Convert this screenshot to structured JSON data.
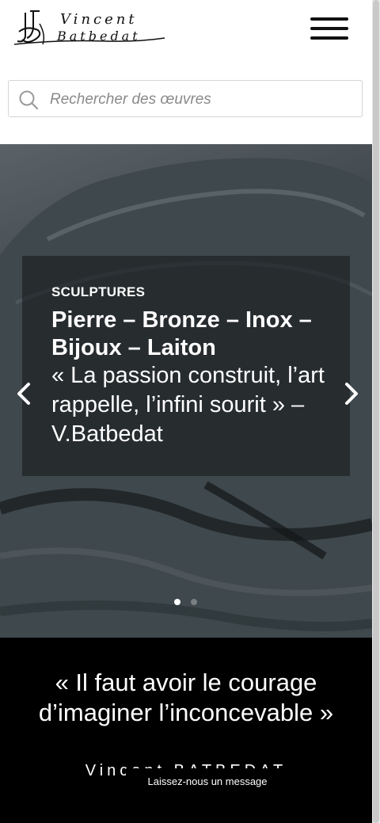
{
  "header": {
    "logo_line1": "Vincent",
    "logo_line2": "Batbedat",
    "menu_icon": "hamburger-menu-icon"
  },
  "search": {
    "placeholder": "Rechercher des œuvres",
    "value": "",
    "icon": "search-icon"
  },
  "slider": {
    "category": "SCULPTURES",
    "title": "Pierre – Bronze – Inox – Bijoux – Laiton",
    "quote": "« La passion construit, l’art rappelle, l’infini sourit » – V.Batbedat",
    "prev_icon": "chevron-left-icon",
    "next_icon": "chevron-right-icon",
    "slide_count": 2,
    "active_slide": 1
  },
  "quote_section": {
    "quote": "« Il faut avoir le courage d’imaginer l’inconcevable »",
    "author": "Vincent BATBEDAT",
    "message_button": "Laissez-nous un message"
  },
  "colors": {
    "accent": "#ffffff",
    "dark": "#000000",
    "text": "#111111"
  }
}
